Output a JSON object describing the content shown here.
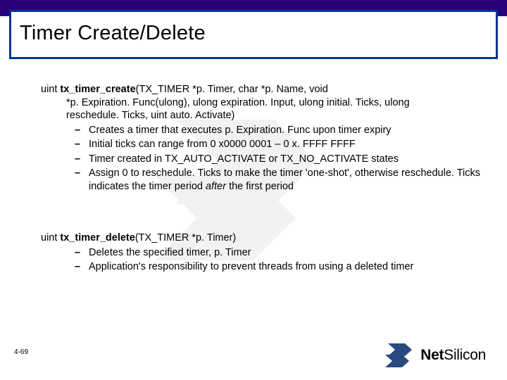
{
  "title": "Timer Create/Delete",
  "func1": {
    "return_type": "uint ",
    "name": "tx_timer_create",
    "params_line1": "(TX_TIMER *p. Timer, char *p. Name, void",
    "params_line2": "*p. Expiration. Func(ulong), ulong expiration. Input, ulong initial. Ticks, ulong",
    "params_line3": "reschedule. Ticks, uint auto. Activate)",
    "bullets": [
      "Creates a timer that executes p. Expiration. Func upon timer expiry",
      "Initial ticks can range from 0 x0000 0001 – 0 x. FFFF FFFF",
      "Timer created in TX_AUTO_ACTIVATE or TX_NO_ACTIVATE states"
    ],
    "bullet4_pre": "Assign 0 to reschedule. Ticks to make the timer 'one-shot', otherwise reschedule. Ticks indicates the timer period ",
    "bullet4_italic": "after",
    "bullet4_post": " the first period"
  },
  "func2": {
    "return_type": "uint ",
    "name": "tx_timer_delete",
    "params": "(TX_TIMER *p. Timer)",
    "bullets": [
      "Deletes the specified timer, p. Timer",
      "Application's responsibility to prevent threads from using a deleted timer"
    ]
  },
  "footer_num": "4-69",
  "logo_text_a": "Net",
  "logo_text_b": "Silicon"
}
